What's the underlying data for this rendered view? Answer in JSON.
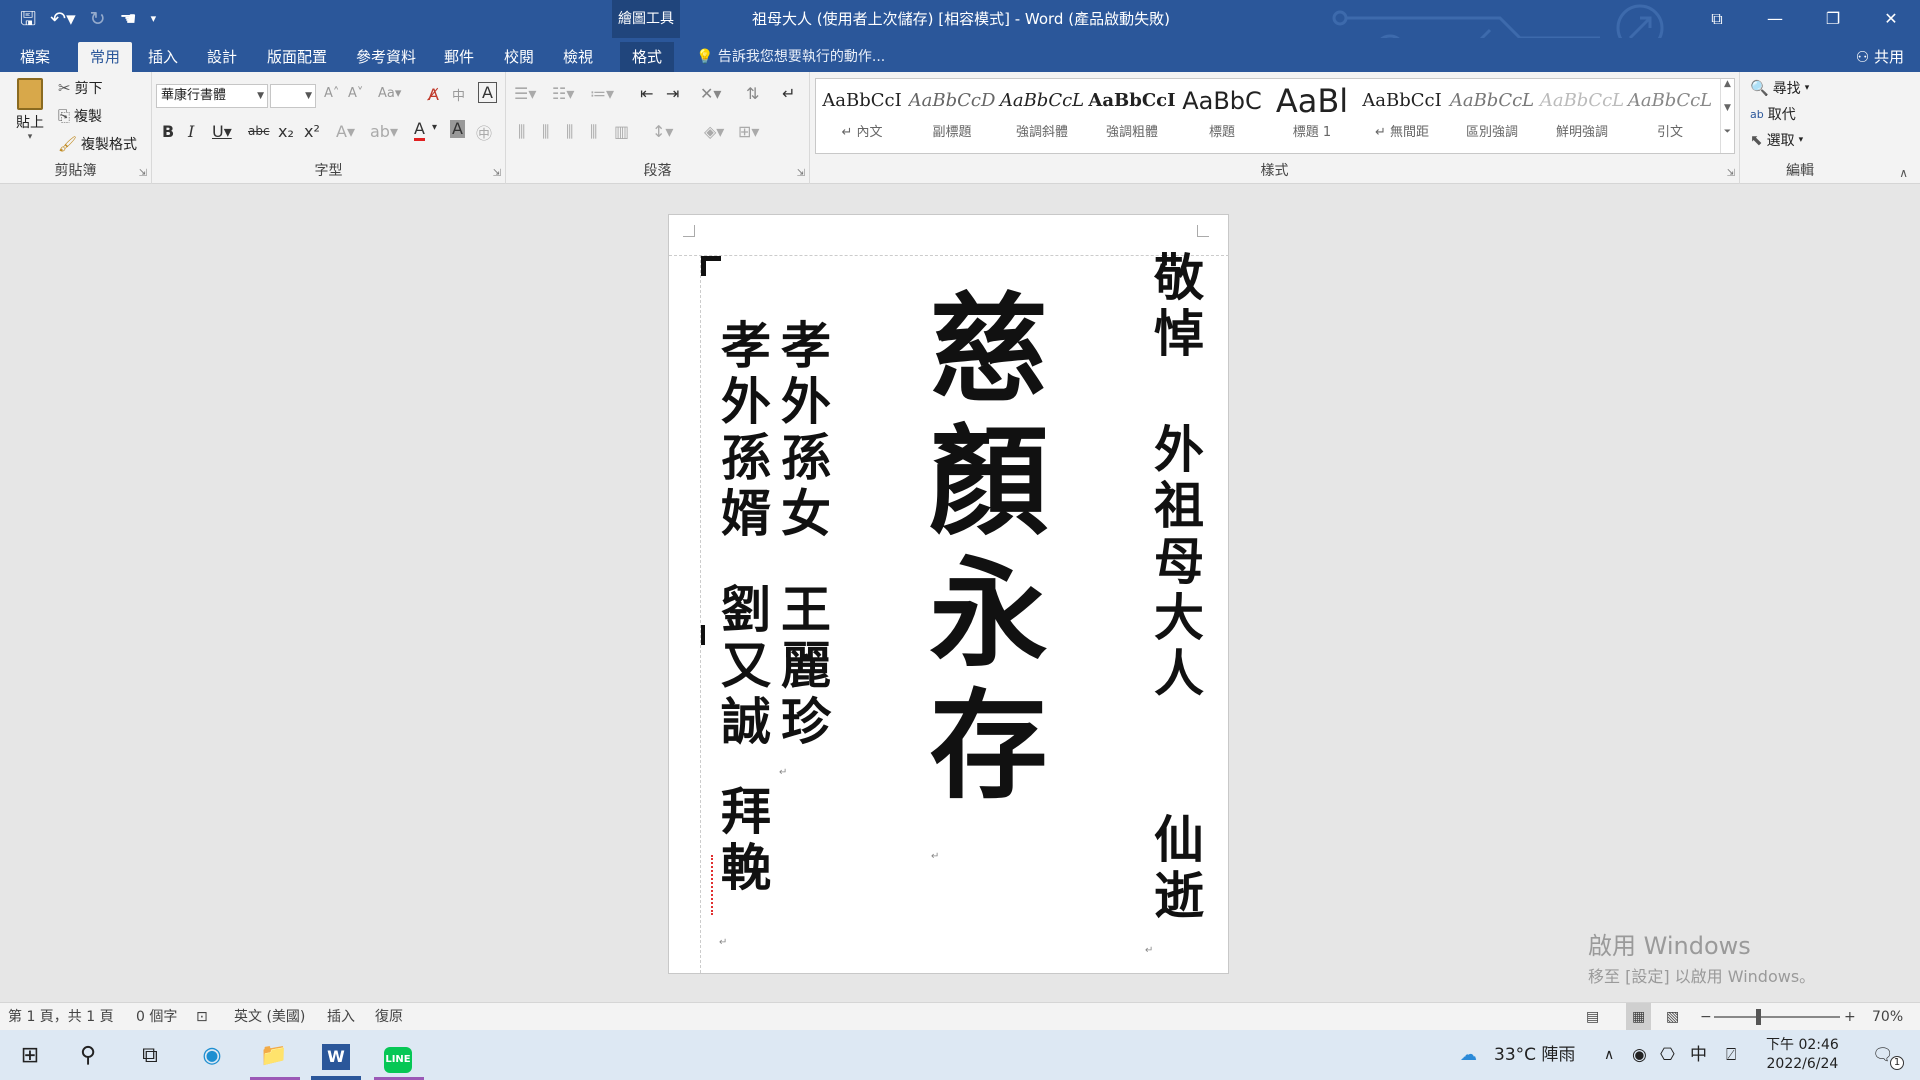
{
  "titlebar": {
    "contextual_tab": "繪圖工具",
    "title": "祖母大人 (使用者上次儲存) [相容模式] - Word (產品啟動失敗)"
  },
  "tabs": [
    {
      "label": "檔案"
    },
    {
      "label": "常用"
    },
    {
      "label": "插入"
    },
    {
      "label": "設計"
    },
    {
      "label": "版面配置"
    },
    {
      "label": "參考資料"
    },
    {
      "label": "郵件"
    },
    {
      "label": "校閱"
    },
    {
      "label": "檢視"
    },
    {
      "label": "格式"
    }
  ],
  "tell_me": "告訴我您想要執行的動作...",
  "share": "共用",
  "clipboard": {
    "paste": "貼上",
    "cut": "剪下",
    "copy": "複製",
    "format_painter": "複製格式",
    "label": "剪貼簿"
  },
  "font": {
    "name": "華康行書體",
    "size": "",
    "label": "字型"
  },
  "paragraph": {
    "label": "段落"
  },
  "styles": {
    "label": "樣式",
    "items": [
      {
        "sample": "AaBbCcI",
        "name": "↵ 內文"
      },
      {
        "sample": "AaBbCcD",
        "name": "副標題"
      },
      {
        "sample": "AaBbCcL",
        "name": "強調斜體"
      },
      {
        "sample": "AaBbCcI",
        "name": "強調粗體"
      },
      {
        "sample": "AaBbC",
        "name": "標題"
      },
      {
        "sample": "AaBl",
        "name": "標題 1"
      },
      {
        "sample": "AaBbCcI",
        "name": "↵ 無間距"
      },
      {
        "sample": "AaBbCcL",
        "name": "區別強調"
      },
      {
        "sample": "AaBbCcL",
        "name": "鮮明強調"
      },
      {
        "sample": "AaBbCcL",
        "name": "引文"
      }
    ]
  },
  "editing": {
    "find": "尋找",
    "replace": "取代",
    "select": "選取",
    "label": "編輯"
  },
  "document": {
    "right_top": "敬悼",
    "right_name": "外祖母大人",
    "right_bottom": "仙逝",
    "center": "慈顏永存",
    "left1_a": "孝外孫女",
    "left1_b": "王麗珍",
    "left2_a": "孝外孫婿",
    "left2_b": "劉又誠",
    "left2_c": "拜輓"
  },
  "watermark": {
    "line1": "啟用 Windows",
    "line2": "移至 [設定] 以啟用 Windows。"
  },
  "status": {
    "page": "第 1 頁，共 1 頁",
    "words": "0 個字",
    "language": "英文 (美國)",
    "mode": "插入",
    "restore": "復原",
    "zoom": "70%"
  },
  "taskbar": {
    "weather": "33°C  陣雨",
    "ime": "中",
    "time": "下午 02:46",
    "date": "2022/6/24",
    "notifications": "1"
  }
}
